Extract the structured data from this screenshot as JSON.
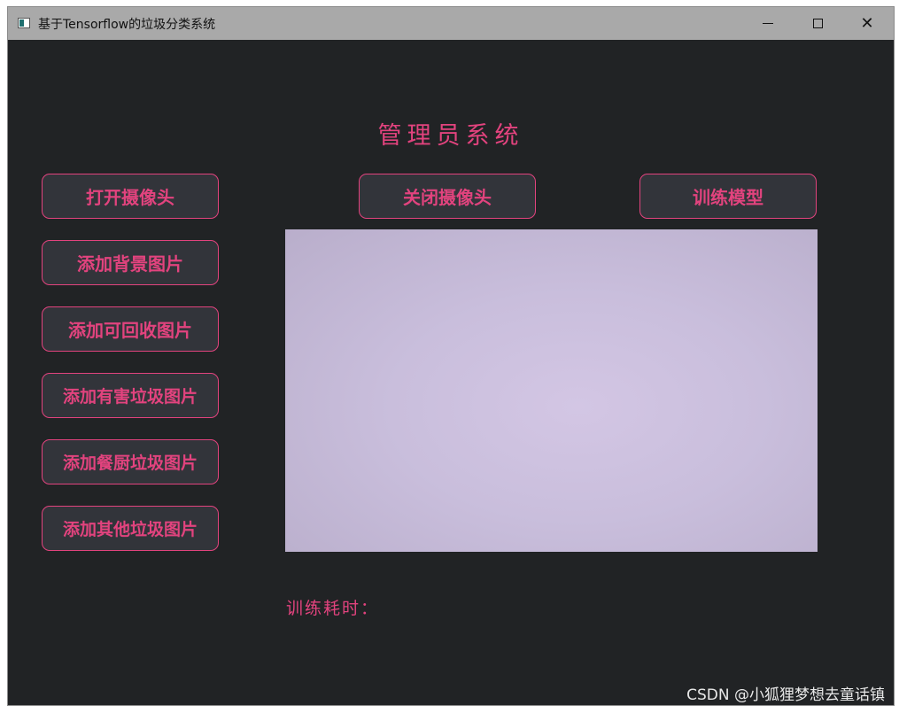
{
  "window": {
    "title": "基于Tensorflow的垃圾分类系统",
    "minimize_icon": "minimize-icon",
    "maximize_icon": "maximize-icon",
    "close_glyph": "✕"
  },
  "main": {
    "heading": "管理员系统",
    "top_buttons": {
      "open_camera": "打开摄像头",
      "close_camera": "关闭摄像头",
      "train_model": "训练模型"
    },
    "left_buttons": [
      "添加背景图片",
      "添加可回收图片",
      "添加有害垃圾图片",
      "添加餐厨垃圾图片",
      "添加其他垃圾图片"
    ],
    "training_time_label": "训练耗时："
  },
  "watermark": "CSDN @小狐狸梦想去童话镇",
  "colors": {
    "accent": "#e2437e",
    "background": "#212325",
    "button_fill": "#32343a",
    "titlebar": "#a9a9a9"
  }
}
